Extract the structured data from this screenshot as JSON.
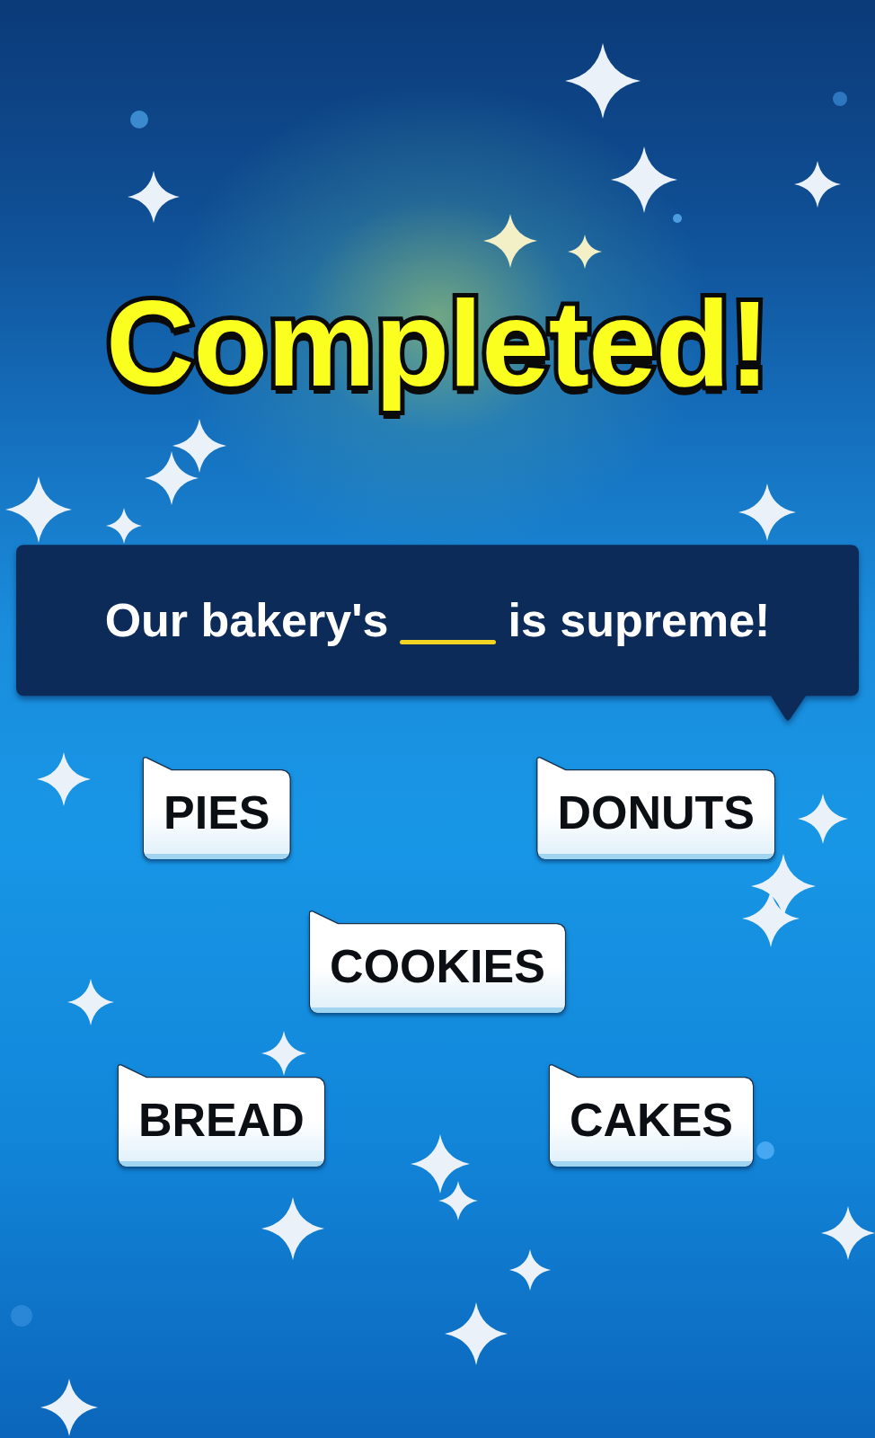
{
  "title": "Completed!",
  "question": {
    "parts": [
      {
        "kind": "text",
        "text": "Our bakery's"
      },
      {
        "kind": "blank"
      },
      {
        "kind": "text",
        "text": "is supreme!"
      }
    ]
  },
  "answer_rows": [
    [
      {
        "label": "PIES"
      },
      {
        "label": "DONUTS"
      }
    ],
    [
      {
        "label": "COOKIES"
      }
    ],
    [
      {
        "label": "BREAD"
      },
      {
        "label": "CAKES"
      }
    ]
  ]
}
